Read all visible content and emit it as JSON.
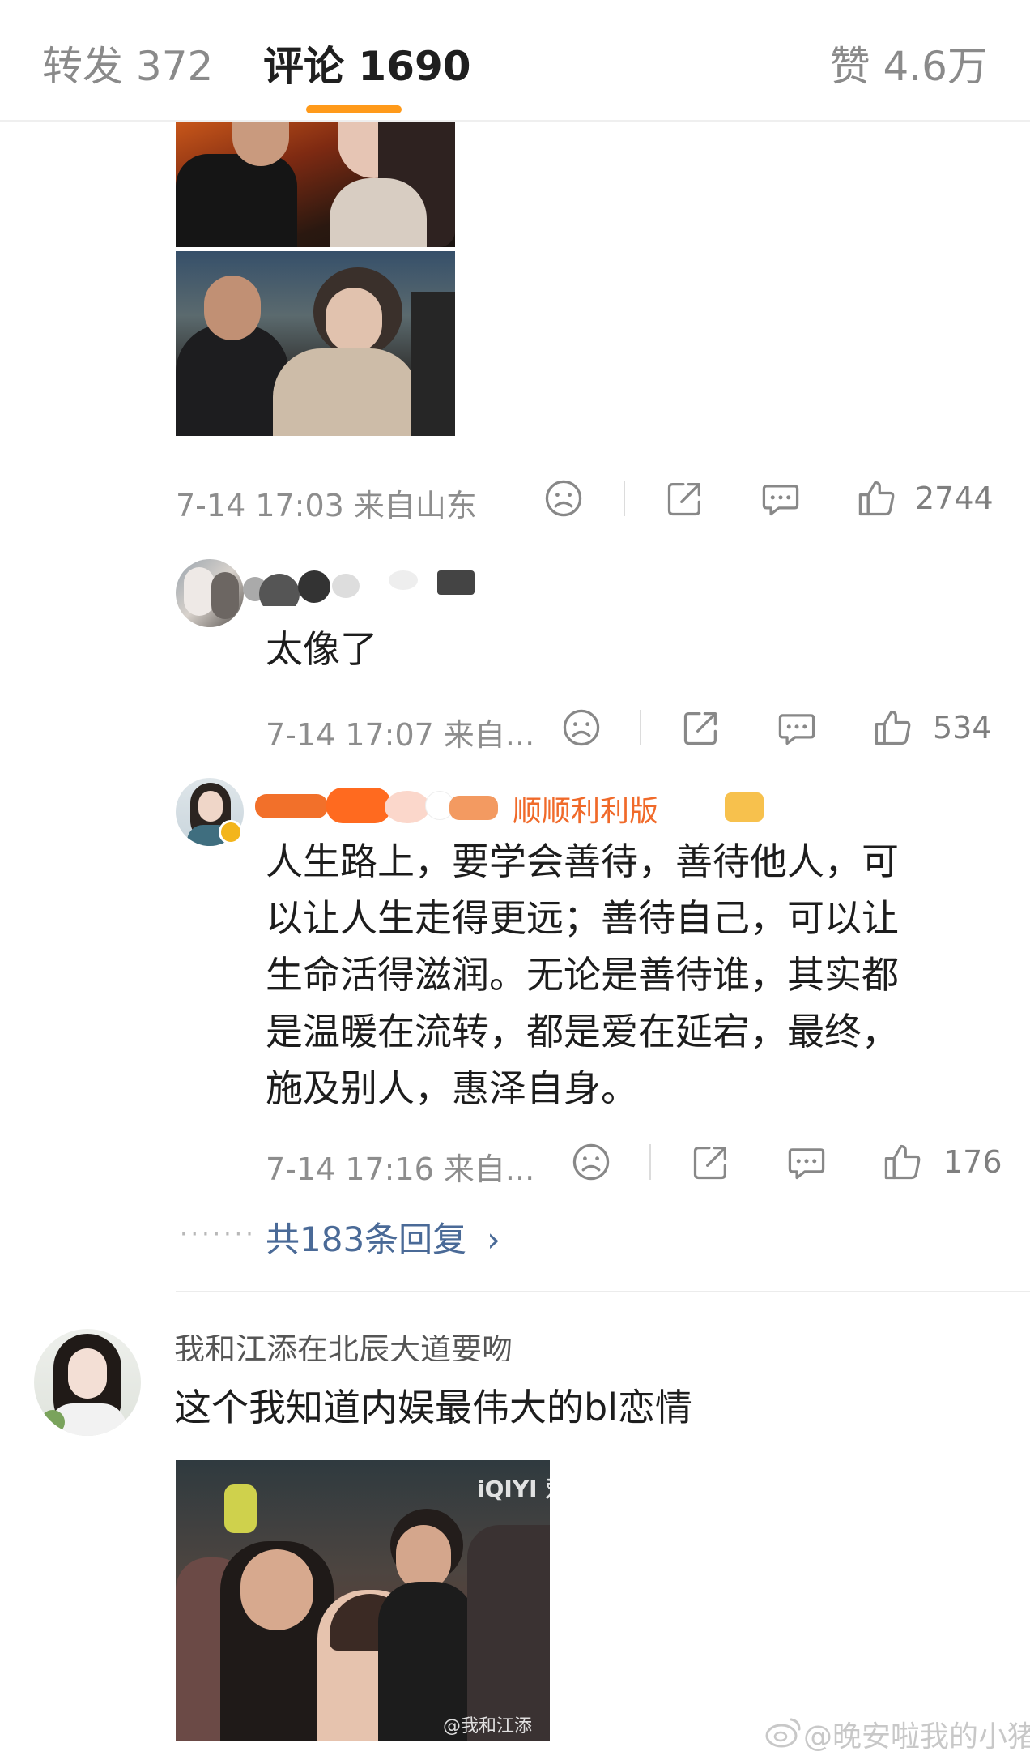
{
  "tabs": {
    "repost": "转发 372",
    "comments": "评论 1690",
    "likes": "赞 4.6万"
  },
  "post_meta": {
    "time_location": "7-14 17:03  来自山东",
    "like_count": "2744"
  },
  "reply1": {
    "text": "太像了",
    "time_location": "7-14 17:07  来自...",
    "like_count": "534"
  },
  "reply2": {
    "name_visible": "顺顺利利版",
    "text_lines": [
      "人生路上，要学会善待，善待他人，可",
      "以让人生走得更远；善待自己，可以让",
      "生命活得滋润。无论是善待谁，其实都",
      "是温暖在流转，都是爱在延宕，最终，",
      "施及别人，惠泽自身。"
    ],
    "time_location": "7-14 17:16  来自...",
    "like_count": "176",
    "more_replies": "共183条回复"
  },
  "comment2": {
    "name_partial": "我和江添在北辰大道要吻",
    "text": "这个我知道内娱最伟大的bl恋情",
    "image_top_label": "iQIYI 爱奇",
    "image_bottom_label": "@我和江添"
  },
  "watermark": "@晚安啦我的小猪",
  "colors": {
    "accent_underline": "#ff9a1a",
    "link_blue": "#4a6a97",
    "meta_gray": "#8d8d8d"
  },
  "icons": [
    "sad-face-icon",
    "share-icon",
    "comment-icon",
    "thumbs-up-icon",
    "chevron-right-icon",
    "weibo-logo-icon"
  ]
}
